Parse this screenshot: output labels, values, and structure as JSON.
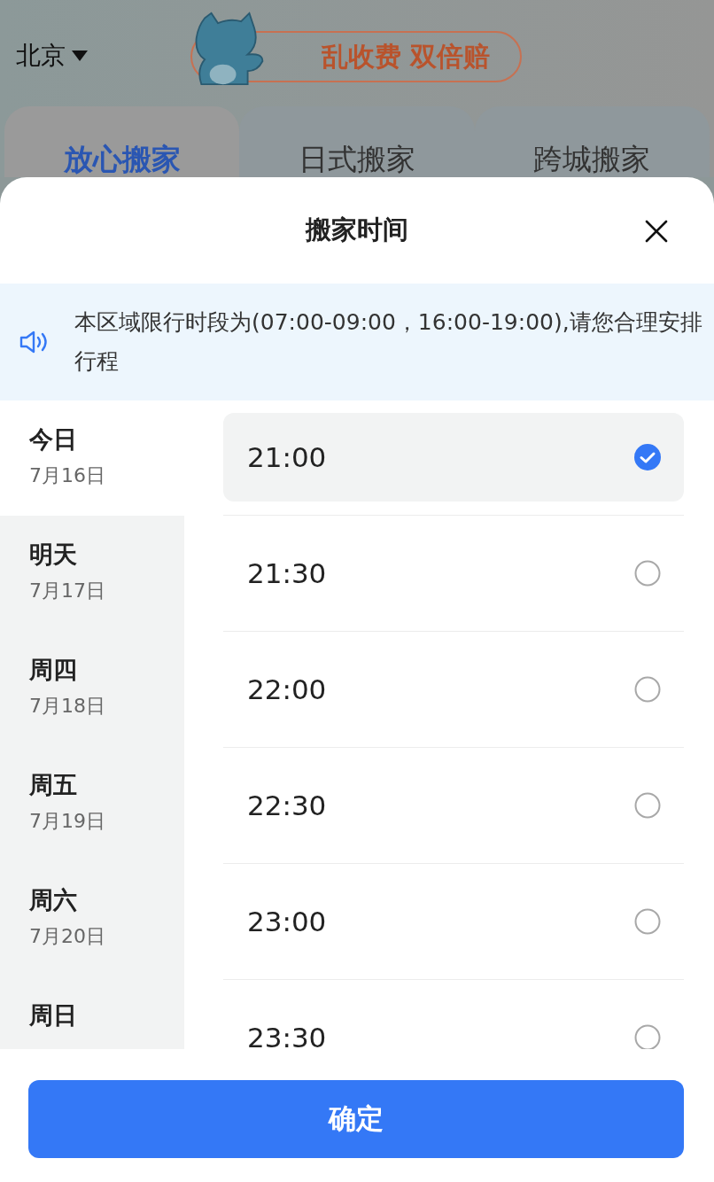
{
  "location": {
    "city": "北京"
  },
  "banner": {
    "text": "乱收费 双倍赔"
  },
  "service_tabs": [
    {
      "label": "放心搬家",
      "selected": true
    },
    {
      "label": "日式搬家",
      "selected": false
    },
    {
      "label": "跨城搬家",
      "selected": false
    }
  ],
  "sheet": {
    "title": "搬家时间"
  },
  "notice": {
    "text": "本区域限行时段为(07:00-09:00，16:00-19:00),请您合理安排行程"
  },
  "days": [
    {
      "label": "今日",
      "date": "7月16日",
      "selected": true
    },
    {
      "label": "明天",
      "date": "7月17日",
      "selected": false
    },
    {
      "label": "周四",
      "date": "7月18日",
      "selected": false
    },
    {
      "label": "周五",
      "date": "7月19日",
      "selected": false
    },
    {
      "label": "周六",
      "date": "7月20日",
      "selected": false
    },
    {
      "label": "周日",
      "selected": false
    }
  ],
  "times": [
    {
      "time": "21:00",
      "selected": true
    },
    {
      "time": "21:30",
      "selected": false
    },
    {
      "time": "22:00",
      "selected": false
    },
    {
      "time": "22:30",
      "selected": false
    },
    {
      "time": "23:00",
      "selected": false
    },
    {
      "time": "23:30",
      "selected": false
    }
  ],
  "confirm_button": "确定"
}
